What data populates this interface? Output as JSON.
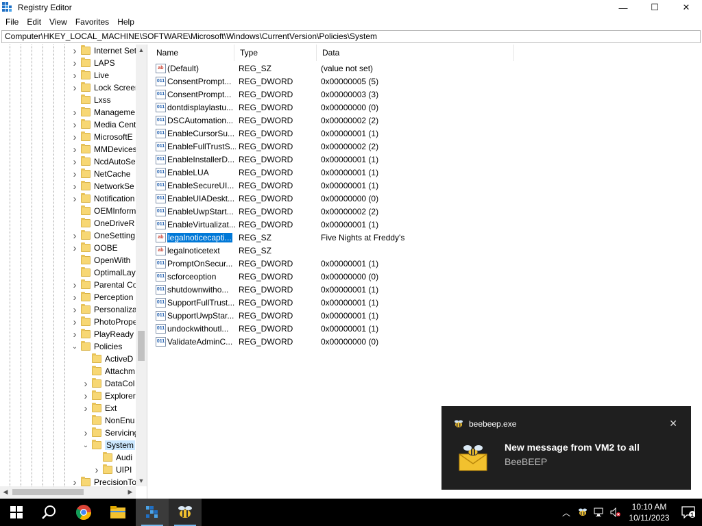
{
  "window": {
    "title": "Registry Editor",
    "controls": {
      "minimize": "—",
      "maximize": "☐",
      "close": "✕"
    }
  },
  "menu": [
    "File",
    "Edit",
    "View",
    "Favorites",
    "Help"
  ],
  "address": "Computer\\HKEY_LOCAL_MACHINE\\SOFTWARE\\Microsoft\\Windows\\CurrentVersion\\Policies\\System",
  "tree": [
    {
      "label": "Internet Set",
      "level": 1,
      "expand": "collapsed"
    },
    {
      "label": "LAPS",
      "level": 1,
      "expand": "collapsed"
    },
    {
      "label": "Live",
      "level": 1,
      "expand": "collapsed"
    },
    {
      "label": "Lock Screen",
      "level": 1,
      "expand": "collapsed"
    },
    {
      "label": "Lxss",
      "level": 1,
      "expand": "none"
    },
    {
      "label": "Manageme",
      "level": 1,
      "expand": "collapsed"
    },
    {
      "label": "Media Cent",
      "level": 1,
      "expand": "collapsed"
    },
    {
      "label": "MicrosoftE",
      "level": 1,
      "expand": "collapsed"
    },
    {
      "label": "MMDevices",
      "level": 1,
      "expand": "collapsed"
    },
    {
      "label": "NcdAutoSe",
      "level": 1,
      "expand": "collapsed"
    },
    {
      "label": "NetCache",
      "level": 1,
      "expand": "collapsed"
    },
    {
      "label": "NetworkSe",
      "level": 1,
      "expand": "collapsed"
    },
    {
      "label": "Notification",
      "level": 1,
      "expand": "collapsed"
    },
    {
      "label": "OEMInform",
      "level": 1,
      "expand": "none"
    },
    {
      "label": "OneDriveR",
      "level": 1,
      "expand": "none"
    },
    {
      "label": "OneSetting",
      "level": 1,
      "expand": "collapsed"
    },
    {
      "label": "OOBE",
      "level": 1,
      "expand": "collapsed"
    },
    {
      "label": "OpenWith",
      "level": 1,
      "expand": "none"
    },
    {
      "label": "OptimalLay",
      "level": 1,
      "expand": "none"
    },
    {
      "label": "Parental Co",
      "level": 1,
      "expand": "collapsed"
    },
    {
      "label": "Perception",
      "level": 1,
      "expand": "collapsed"
    },
    {
      "label": "Personaliza",
      "level": 1,
      "expand": "collapsed"
    },
    {
      "label": "PhotoPrope",
      "level": 1,
      "expand": "collapsed"
    },
    {
      "label": "PlayReady",
      "level": 1,
      "expand": "collapsed"
    },
    {
      "label": "Policies",
      "level": 1,
      "expand": "expanded"
    },
    {
      "label": "ActiveD",
      "level": 2,
      "expand": "none"
    },
    {
      "label": "Attachm",
      "level": 2,
      "expand": "none"
    },
    {
      "label": "DataCol",
      "level": 2,
      "expand": "collapsed"
    },
    {
      "label": "Explorer",
      "level": 2,
      "expand": "collapsed"
    },
    {
      "label": "Ext",
      "level": 2,
      "expand": "collapsed"
    },
    {
      "label": "NonEnu",
      "level": 2,
      "expand": "none"
    },
    {
      "label": "Servicing",
      "level": 2,
      "expand": "collapsed"
    },
    {
      "label": "System",
      "level": 2,
      "expand": "expanded",
      "selected": true
    },
    {
      "label": "Audi",
      "level": 3,
      "expand": "none"
    },
    {
      "label": "UIPI",
      "level": 3,
      "expand": "collapsed"
    },
    {
      "label": "PrecisionTo",
      "level": 1,
      "expand": "collapsed"
    }
  ],
  "columns": {
    "name": "Name",
    "type": "Type",
    "data": "Data"
  },
  "values": [
    {
      "name": "(Default)",
      "type": "REG_SZ",
      "data": "(value not set)",
      "kind": "sz"
    },
    {
      "name": "ConsentPrompt...",
      "type": "REG_DWORD",
      "data": "0x00000005 (5)",
      "kind": "dword"
    },
    {
      "name": "ConsentPrompt...",
      "type": "REG_DWORD",
      "data": "0x00000003 (3)",
      "kind": "dword"
    },
    {
      "name": "dontdisplaylastu...",
      "type": "REG_DWORD",
      "data": "0x00000000 (0)",
      "kind": "dword"
    },
    {
      "name": "DSCAutomation...",
      "type": "REG_DWORD",
      "data": "0x00000002 (2)",
      "kind": "dword"
    },
    {
      "name": "EnableCursorSu...",
      "type": "REG_DWORD",
      "data": "0x00000001 (1)",
      "kind": "dword"
    },
    {
      "name": "EnableFullTrustS...",
      "type": "REG_DWORD",
      "data": "0x00000002 (2)",
      "kind": "dword"
    },
    {
      "name": "EnableInstallerD...",
      "type": "REG_DWORD",
      "data": "0x00000001 (1)",
      "kind": "dword"
    },
    {
      "name": "EnableLUA",
      "type": "REG_DWORD",
      "data": "0x00000001 (1)",
      "kind": "dword"
    },
    {
      "name": "EnableSecureUI...",
      "type": "REG_DWORD",
      "data": "0x00000001 (1)",
      "kind": "dword"
    },
    {
      "name": "EnableUIADeskt...",
      "type": "REG_DWORD",
      "data": "0x00000000 (0)",
      "kind": "dword"
    },
    {
      "name": "EnableUwpStart...",
      "type": "REG_DWORD",
      "data": "0x00000002 (2)",
      "kind": "dword"
    },
    {
      "name": "EnableVirtualizat...",
      "type": "REG_DWORD",
      "data": "0x00000001 (1)",
      "kind": "dword"
    },
    {
      "name": "legalnoticecapti...",
      "type": "REG_SZ",
      "data": "Five Nights at Freddy's",
      "kind": "sz",
      "selected": true
    },
    {
      "name": "legalnoticetext",
      "type": "REG_SZ",
      "data": "",
      "kind": "sz"
    },
    {
      "name": "PromptOnSecur...",
      "type": "REG_DWORD",
      "data": "0x00000001 (1)",
      "kind": "dword"
    },
    {
      "name": "scforceoption",
      "type": "REG_DWORD",
      "data": "0x00000000 (0)",
      "kind": "dword"
    },
    {
      "name": "shutdownwitho...",
      "type": "REG_DWORD",
      "data": "0x00000001 (1)",
      "kind": "dword"
    },
    {
      "name": "SupportFullTrust...",
      "type": "REG_DWORD",
      "data": "0x00000001 (1)",
      "kind": "dword"
    },
    {
      "name": "SupportUwpStar...",
      "type": "REG_DWORD",
      "data": "0x00000001 (1)",
      "kind": "dword"
    },
    {
      "name": "undockwithoutl...",
      "type": "REG_DWORD",
      "data": "0x00000001 (1)",
      "kind": "dword"
    },
    {
      "name": "ValidateAdminC...",
      "type": "REG_DWORD",
      "data": "0x00000000 (0)",
      "kind": "dword"
    }
  ],
  "toast": {
    "app": "beebeep.exe",
    "title": "New message from VM2 to all",
    "body": "BeeBEEP",
    "close": "✕"
  },
  "taskbar": {
    "apps": [
      "start-icon",
      "search-icon",
      "chrome-icon",
      "file-explorer-icon",
      "registry-editor-icon",
      "beebeep-icon"
    ],
    "tray_chevron": "︿",
    "time": "10:10 AM",
    "date": "10/11/2023",
    "notification_count": "1"
  },
  "colors": {
    "selection": "#0078d7",
    "toast_bg": "#1f1f1f",
    "taskbar_bg": "#000000",
    "folder": "#f7d774"
  }
}
